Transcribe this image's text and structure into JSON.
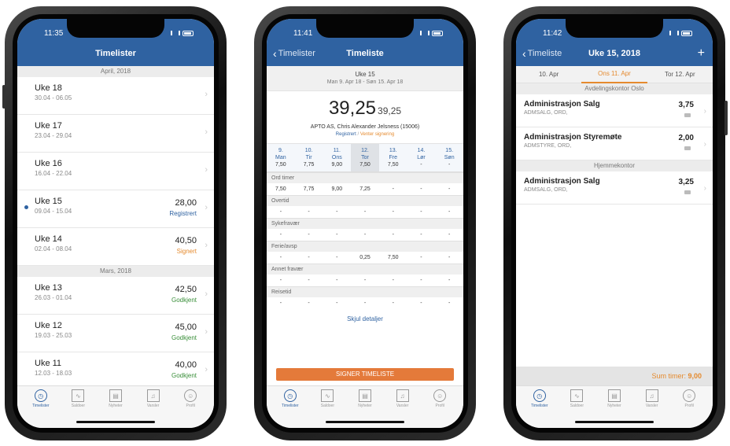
{
  "tabbar": {
    "items": [
      {
        "label": "Timelister",
        "icon": "clock-icon"
      },
      {
        "label": "Saldoer",
        "icon": "chart-icon"
      },
      {
        "label": "Nyheter",
        "icon": "news-icon"
      },
      {
        "label": "Varsler",
        "icon": "bell-icon"
      },
      {
        "label": "Profil",
        "icon": "profile-icon"
      }
    ],
    "active_color": "#2f62a1"
  },
  "phone1": {
    "time": "11:35",
    "title": "Timelister",
    "sections": [
      {
        "header": "April, 2018",
        "weeks": [
          {
            "title": "Uke 18",
            "range": "30.04 - 06.05",
            "hours": "",
            "status": ""
          },
          {
            "title": "Uke 17",
            "range": "23.04 - 29.04",
            "hours": "",
            "status": ""
          },
          {
            "title": "Uke 16",
            "range": "16.04 - 22.04",
            "hours": "",
            "status": ""
          },
          {
            "title": "Uke 15",
            "range": "09.04 - 15.04",
            "hours": "28,00",
            "status": "Registrert"
          },
          {
            "title": "Uke 14",
            "range": "02.04 - 08.04",
            "hours": "40,50",
            "status": "Signert"
          }
        ]
      },
      {
        "header": "Mars, 2018",
        "weeks": [
          {
            "title": "Uke 13",
            "range": "26.03 - 01.04",
            "hours": "42,50",
            "status": "Godkjent"
          },
          {
            "title": "Uke 12",
            "range": "19.03 - 25.03",
            "hours": "45,00",
            "status": "Godkjent"
          },
          {
            "title": "Uke 11",
            "range": "12.03 - 18.03",
            "hours": "40,00",
            "status": "Godkjent"
          }
        ]
      }
    ],
    "status_colors": {
      "Registrert": "#2f62a1",
      "Signert": "#e58a2e",
      "Godkjent": "#3a8f3a"
    }
  },
  "phone2": {
    "time": "11:41",
    "back_label": "Timelister",
    "title": "Timeliste",
    "week_label": "Uke 15",
    "week_range": "Man 9. Apr 18 - Søn 15. Apr 18",
    "total_main": "39,25",
    "total_secondary": "39,25",
    "person": "APTO AS, Chris Alexander Jelsness (15006)",
    "status_registered": "Registrert",
    "status_separator": " / ",
    "status_pending": "Venter signering",
    "days": [
      {
        "num": "9.",
        "name": "Man",
        "hours": "7,50"
      },
      {
        "num": "10.",
        "name": "Tir",
        "hours": "7,75"
      },
      {
        "num": "11.",
        "name": "Ons",
        "hours": "9,00"
      },
      {
        "num": "12.",
        "name": "Tor",
        "hours": "7,50"
      },
      {
        "num": "13.",
        "name": "Fre",
        "hours": "7,50"
      },
      {
        "num": "14.",
        "name": "Lør",
        "hours": "-"
      },
      {
        "num": "15.",
        "name": "Søn",
        "hours": "-"
      }
    ],
    "categories": [
      {
        "label": "Ord timer",
        "values": [
          "7,50",
          "7,75",
          "9,00",
          "7,25",
          "-",
          "-",
          "-"
        ]
      },
      {
        "label": "Overtid",
        "values": [
          "-",
          "-",
          "-",
          "-",
          "-",
          "-",
          "-"
        ]
      },
      {
        "label": "Sykefravær",
        "values": [
          "-",
          "-",
          "-",
          "-",
          "-",
          "-",
          "-"
        ]
      },
      {
        "label": "Ferie/avsp",
        "values": [
          "-",
          "-",
          "-",
          "0,25",
          "7,50",
          "-",
          "-"
        ]
      },
      {
        "label": "Annet fravær",
        "values": [
          "-",
          "-",
          "-",
          "-",
          "-",
          "-",
          "-"
        ]
      },
      {
        "label": "Reisetid",
        "values": [
          "-",
          "-",
          "-",
          "-",
          "-",
          "-",
          "-"
        ]
      }
    ],
    "toggle_label": "Skjul detaljer",
    "sign_button": "SIGNER TIMELISTE"
  },
  "phone3": {
    "time": "11:42",
    "back_label": "Timeliste",
    "title": "Uke 15, 2018",
    "plus": "+",
    "day_strip": [
      "10. Apr",
      "Ons 11. Apr",
      "Tor 12. Apr"
    ],
    "groups": [
      {
        "header": "Avdelingskontor Oslo",
        "entries": [
          {
            "title": "Administrasjon Salg",
            "code": "ADMSALG, ORD,",
            "hours": "3,75"
          },
          {
            "title": "Administrasjon Styremøte",
            "code": "ADMSTYRE, ORD,",
            "hours": "2,00"
          }
        ]
      },
      {
        "header": "Hjemmekontor",
        "entries": [
          {
            "title": "Administrasjon Salg",
            "code": "ADMSALG, ORD,",
            "hours": "3,25"
          }
        ]
      }
    ],
    "sum_label": "Sum timer: ",
    "sum_value": "9,00"
  }
}
